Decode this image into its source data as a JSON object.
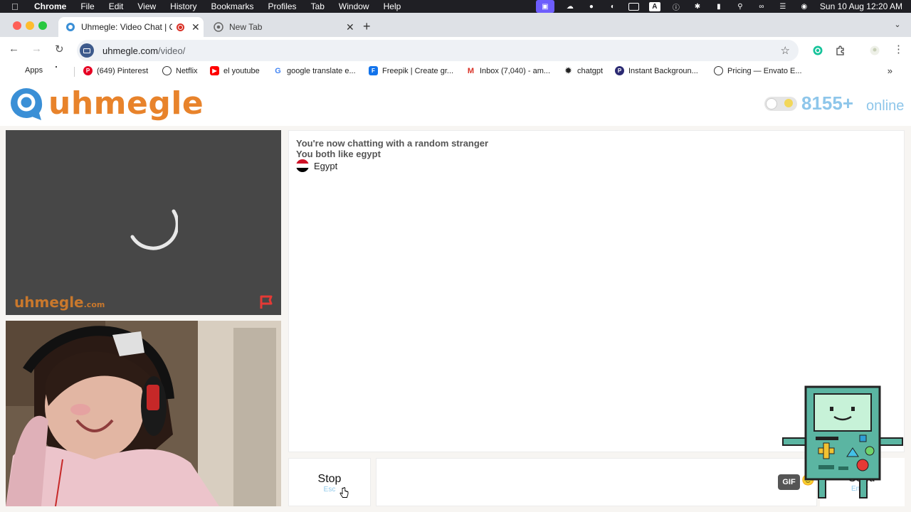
{
  "menubar": {
    "app": "Chrome",
    "items": [
      "File",
      "Edit",
      "View",
      "History",
      "Bookmarks",
      "Profiles",
      "Tab",
      "Window",
      "Help"
    ],
    "clock": "Sun 10 Aug  12:20 AM"
  },
  "tabs": [
    {
      "title": "Uhmegle: Video Chat | Om"
    },
    {
      "title": "New Tab"
    }
  ],
  "address": {
    "host": "uhmegle.com",
    "path": "/video/"
  },
  "bookmarks": [
    {
      "label": "Apps"
    },
    {
      "label": "(649) Pinterest"
    },
    {
      "label": "Netflix"
    },
    {
      "label": "el youtube"
    },
    {
      "label": "google translate e..."
    },
    {
      "label": "Freepik | Create gr..."
    },
    {
      "label": "Inbox (7,040) - am..."
    },
    {
      "label": "chatgpt"
    },
    {
      "label": "Instant Backgroun..."
    },
    {
      "label": "Pricing — Envato E..."
    }
  ],
  "site": {
    "logo": "uhmegle",
    "online_count": "8155+",
    "online_label": "online",
    "watermark": "uhmegle",
    "watermark_suffix": ".com"
  },
  "chat": {
    "line1": "You're now chatting with a random stranger",
    "line2": "You both like egypt",
    "country": "Egypt"
  },
  "controls": {
    "stop_label": "Stop",
    "stop_hint": "Esc",
    "gif_label": "GIF",
    "send_label": "Send",
    "send_hint": "Enter"
  },
  "colors": {
    "brand_orange": "#e8832b",
    "brand_blue": "#3a8fd6",
    "hint_blue": "#8fc9ea"
  }
}
